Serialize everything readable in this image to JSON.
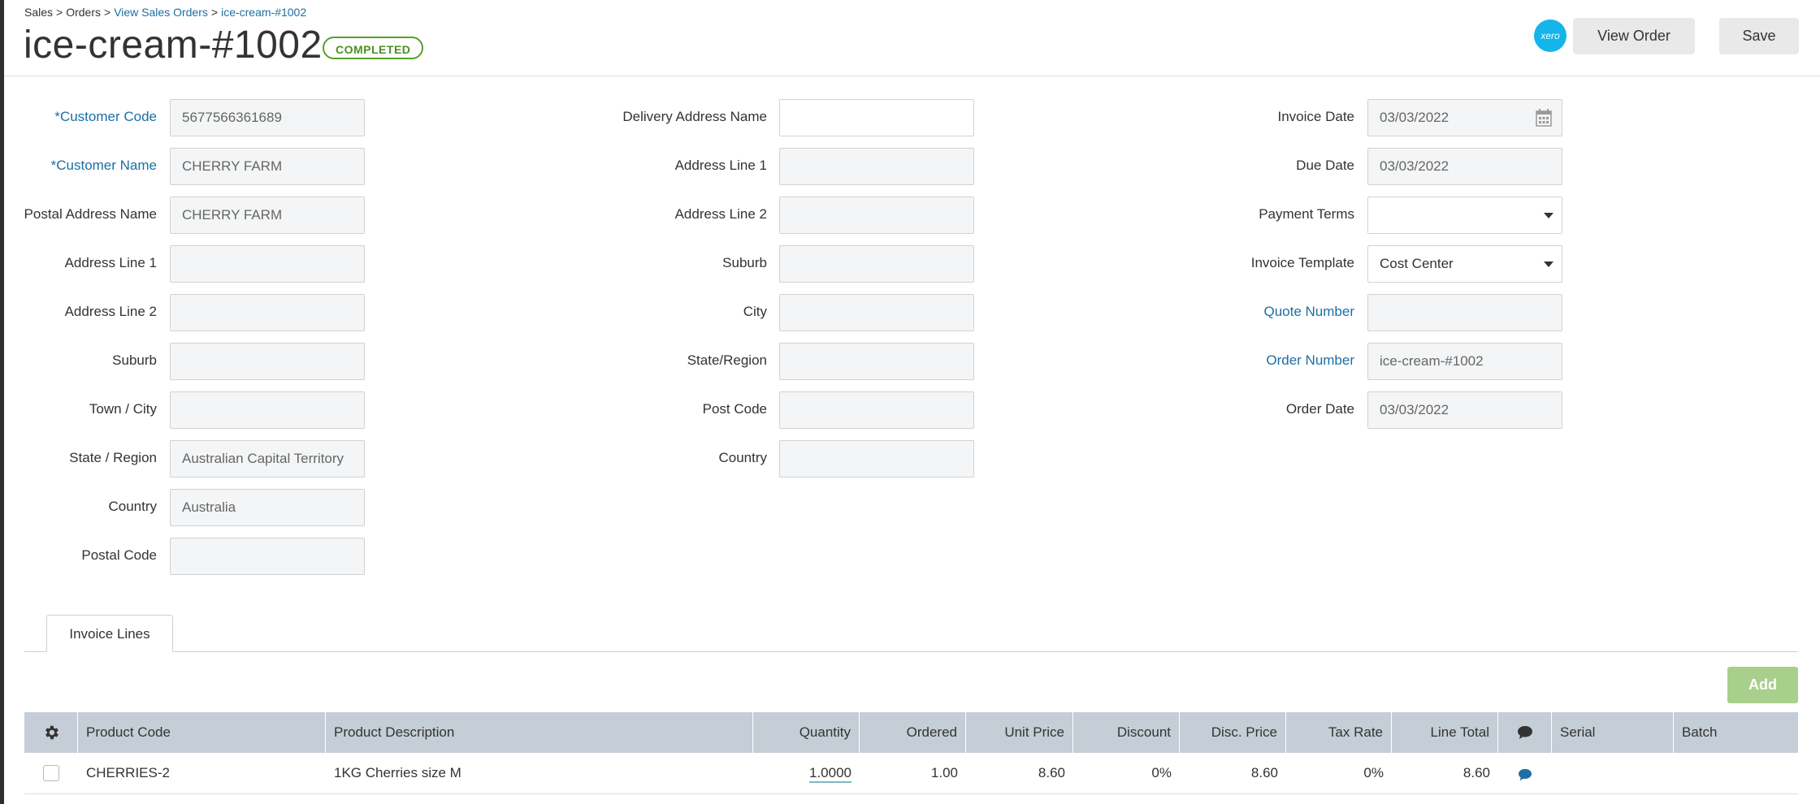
{
  "breadcrumb": {
    "sales": "Sales",
    "orders": "Orders",
    "view_sales_orders": "View Sales Orders",
    "current": "ice-cream-#1002",
    "separator": ">"
  },
  "header": {
    "title": "ice-cream-#1002",
    "status": "COMPLETED",
    "xero_label": "xero",
    "view_order_label": "View Order",
    "save_label": "Save"
  },
  "customer": {
    "customer_code": {
      "label": "*Customer Code",
      "value": "5677566361689"
    },
    "customer_name": {
      "label": "*Customer Name",
      "value": "CHERRY FARM"
    },
    "postal_address_name": {
      "label": "Postal Address Name",
      "value": "CHERRY FARM"
    },
    "address_line_1": {
      "label": "Address Line 1",
      "value": ""
    },
    "address_line_2": {
      "label": "Address Line 2",
      "value": ""
    },
    "suburb": {
      "label": "Suburb",
      "value": ""
    },
    "town_city": {
      "label": "Town / City",
      "value": ""
    },
    "state_region": {
      "label": "State / Region",
      "value": "Australian Capital Territory"
    },
    "country": {
      "label": "Country",
      "value": "Australia"
    },
    "postal_code": {
      "label": "Postal Code",
      "value": ""
    }
  },
  "delivery": {
    "delivery_address_name": {
      "label": "Delivery Address Name",
      "value": ""
    },
    "address_line_1": {
      "label": "Address Line 1",
      "value": ""
    },
    "address_line_2": {
      "label": "Address Line 2",
      "value": ""
    },
    "suburb": {
      "label": "Suburb",
      "value": ""
    },
    "city": {
      "label": "City",
      "value": ""
    },
    "state_region": {
      "label": "State/Region",
      "value": ""
    },
    "post_code": {
      "label": "Post Code",
      "value": ""
    },
    "country": {
      "label": "Country",
      "value": ""
    }
  },
  "invoice": {
    "invoice_date": {
      "label": "Invoice Date",
      "value": "03/03/2022"
    },
    "due_date": {
      "label": "Due Date",
      "value": "03/03/2022"
    },
    "payment_terms": {
      "label": "Payment Terms",
      "value": ""
    },
    "invoice_template": {
      "label": "Invoice Template",
      "value": "Cost Center"
    },
    "quote_number": {
      "label": "Quote Number",
      "value": ""
    },
    "order_number": {
      "label": "Order Number",
      "value": "ice-cream-#1002"
    },
    "order_date": {
      "label": "Order Date",
      "value": "03/03/2022"
    }
  },
  "tabs": {
    "invoice_lines": "Invoice Lines"
  },
  "lines": {
    "add_label": "Add",
    "columns": [
      "Product Code",
      "Product Description",
      "Quantity",
      "Ordered",
      "Unit Price",
      "Discount",
      "Disc. Price",
      "Tax Rate",
      "Line Total",
      "Serial",
      "Batch"
    ],
    "rows": [
      {
        "product_code": "CHERRIES-2",
        "product_description": "1KG Cherries size M",
        "quantity": "1.0000",
        "ordered": "1.00",
        "unit_price": "8.60",
        "discount": "0%",
        "disc_price": "8.60",
        "tax_rate": "0%",
        "line_total": "8.60",
        "serial": "",
        "batch": ""
      }
    ]
  },
  "icons": {
    "gear": "gear-icon",
    "comment": "comment-icon",
    "calendar": "calendar-icon",
    "dropdown": "chevron-down-icon"
  },
  "colors": {
    "link": "#1b6fa3",
    "status": "#5a9f2a",
    "add_button": "#a9cf8d",
    "grid_header": "#c5ced6",
    "xero": "#13b5ea"
  }
}
